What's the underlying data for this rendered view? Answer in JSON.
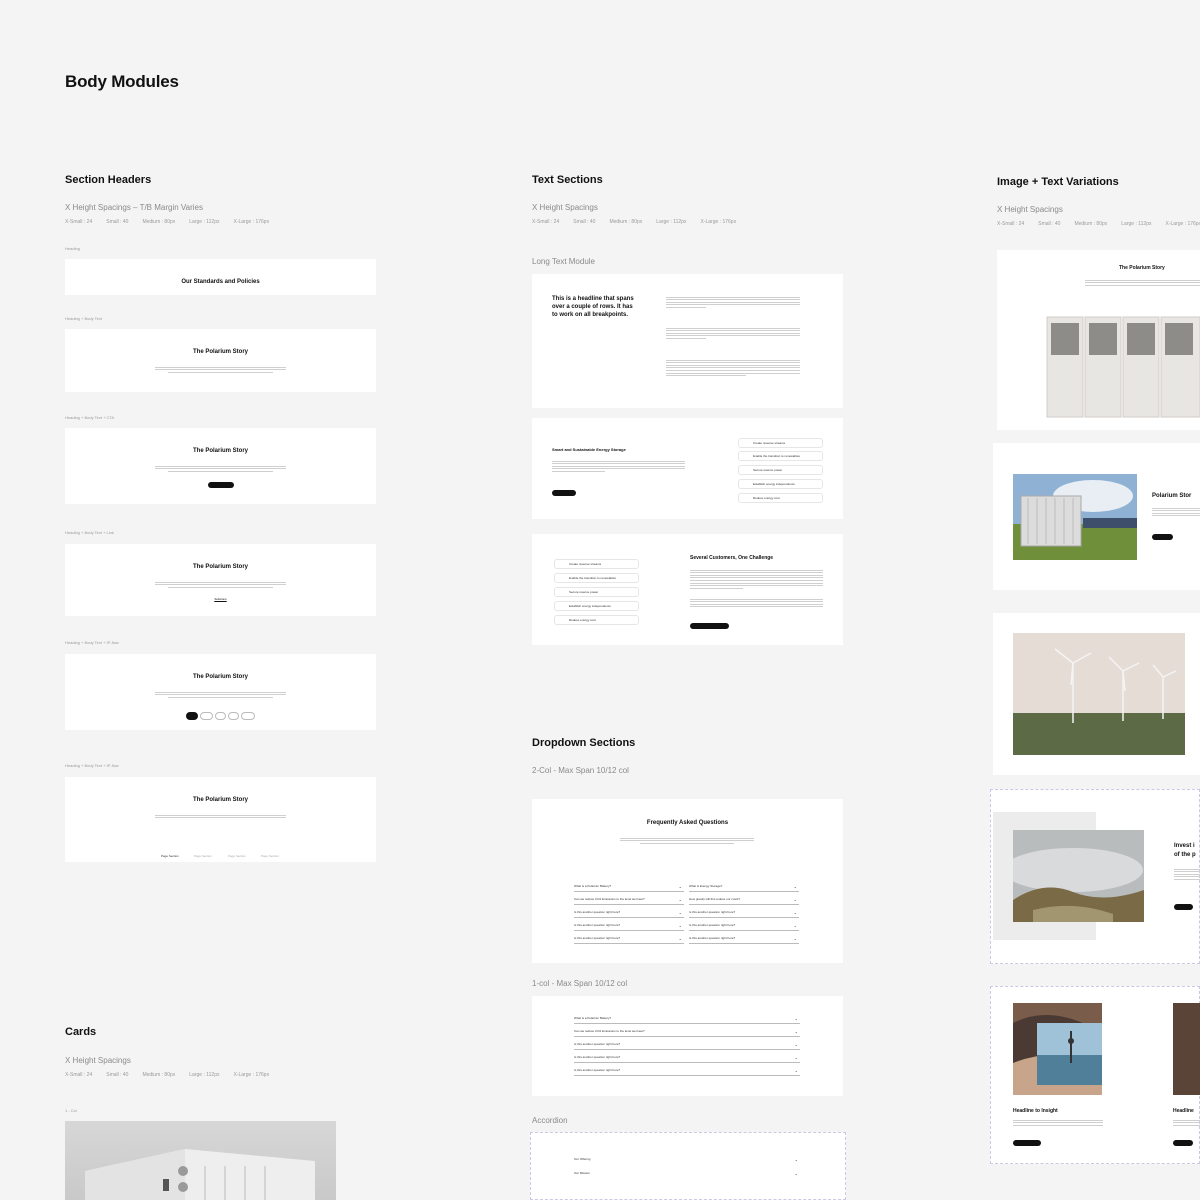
{
  "page_title": "Body Modules",
  "spacings": [
    "X-Small : 24",
    "Small : 40",
    "Medium : 80px",
    "Large : 112px",
    "X-Large : 176px"
  ],
  "section_headers": {
    "title": "Section Headers",
    "subtitle": "X Height Spacings – T/B Margin Varies",
    "variants": [
      {
        "label": "Heading",
        "heading": "Our Standards and Policies"
      },
      {
        "label": "Heading + Body Text",
        "heading": "The Polarium Story"
      },
      {
        "label": "Heading + Body Text + CTA",
        "heading": "The Polarium Story"
      },
      {
        "label": "Heading + Body Text + Link",
        "heading": "The Polarium Story",
        "link": "Solutions"
      },
      {
        "label": "Heading + Body Text + IP-Nav",
        "heading": "The Polarium Story"
      },
      {
        "label": "Heading + Body Text + IP-Nav",
        "heading": "The Polarium Story",
        "tabs": [
          "Page Section",
          "Page Section",
          "Page Section",
          "Page Section"
        ]
      }
    ]
  },
  "text_sections": {
    "title": "Text Sections",
    "subtitle": "X Height Spacings",
    "long_text_label": "Long Text Module",
    "long_text_headline": "This is a headline that spans over a couple of rows. It has to work on all breakpoints.",
    "smart_title": "Smart and Sustainable Energy Storage",
    "customers_title": "Several Customers, One Challenge",
    "features": [
      "Create revenue streams",
      "Enable the transition to renewables",
      "Secure reserve power",
      "Establish energy independence",
      "Reduce energy cost"
    ]
  },
  "dropdown_sections": {
    "title": "Dropdown Sections",
    "two_col_label": "2-Col - Max Span 10/12 col",
    "faq_title": "Frequently Asked Questions",
    "faq_left": [
      "What is a Polarium Battery?",
      "Can we reduce CO2 Emissions to the level we have?",
      "Is this another question right here?",
      "Is this another question right here?",
      "Is this another question right here?"
    ],
    "faq_right": [
      "What is Energy Storage?",
      "How greatly will this reduce our costs?",
      "Is this another question right here?",
      "Is this another question right here?",
      "Is this another question right here?"
    ],
    "one_col_label": "1-col - Max Span 10/12 col",
    "faq_one": [
      "What is a Polarium Battery?",
      "Can we reduce CO2 Emissions to the level we have?",
      "Is this another question right here?",
      "Is this another question right here?",
      "Is this another question right here?"
    ],
    "accordion_label": "Accordion",
    "accordion_items": [
      "Our Offering",
      "Our Mission"
    ]
  },
  "image_text": {
    "title": "Image + Text Variations",
    "subtitle": "X Height Spacings",
    "story_title": "The Polarium Story",
    "story_title_cut": "Polarium Stor",
    "invest_title": "Invest i\nof the p",
    "headline": "Headline to Insight",
    "headline_cut": "Headline"
  },
  "cards": {
    "title": "Cards",
    "subtitle": "X Height Spacings",
    "label": "1 - Col"
  },
  "colors": {
    "background": "#f4f4f4",
    "card": "#ffffff",
    "accent": "#111111"
  }
}
